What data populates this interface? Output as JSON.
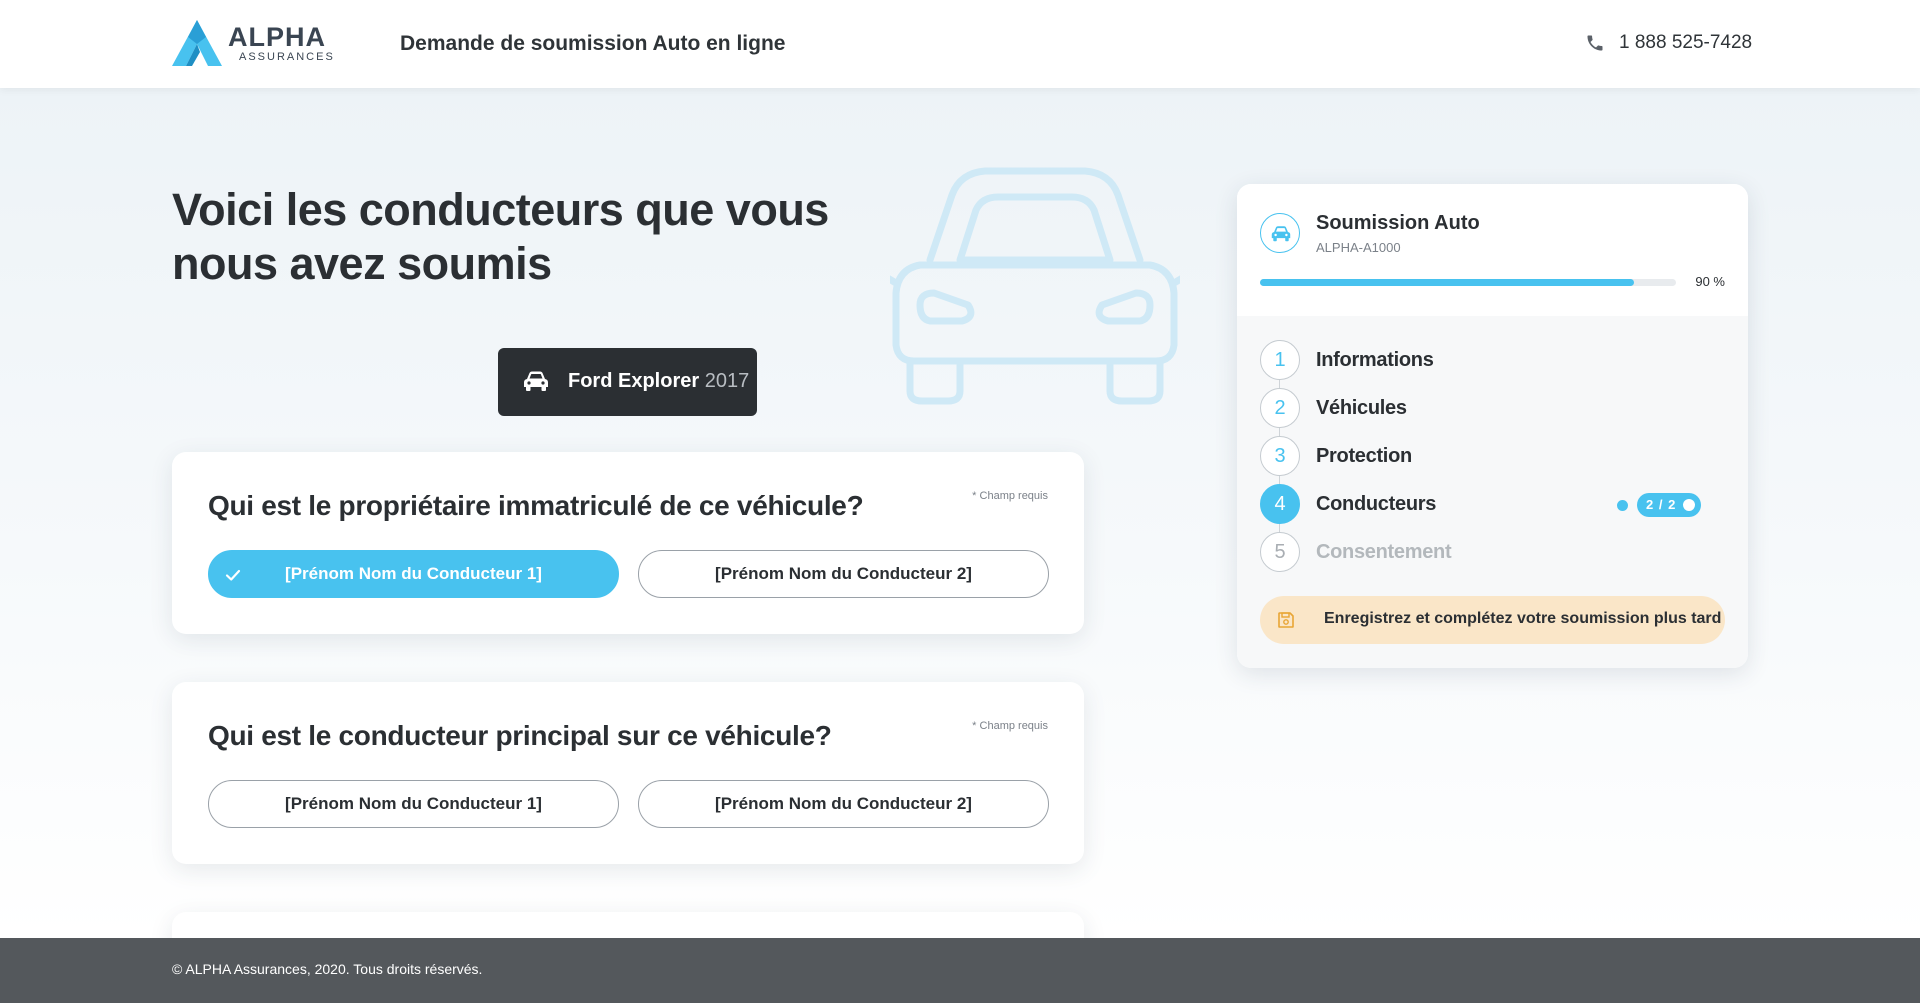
{
  "header": {
    "logo_name": "ALPHA",
    "logo_sub": "ASSURANCES",
    "title": "Demande de soumission Auto en ligne",
    "phone": "1 888 525-7428"
  },
  "main": {
    "heading": "Voici les conducteurs que vous nous avez soumis",
    "vehicle": {
      "make_model": "Ford Explorer",
      "year": "2017"
    },
    "questions": [
      {
        "title": "Qui est le propriétaire immatriculé de ce véhicule?",
        "required": "* Champ requis",
        "options": [
          "[Prénom Nom du Conducteur 1]",
          "[Prénom Nom du Conducteur 2]"
        ],
        "selected": 0
      },
      {
        "title": "Qui est le conducteur principal sur ce véhicule?",
        "required": "* Champ requis",
        "options": [
          "[Prénom Nom du Conducteur 1]",
          "[Prénom Nom du Conducteur 2]"
        ],
        "selected": null
      }
    ]
  },
  "sidebar": {
    "title": "Soumission Auto",
    "ref": "ALPHA-A1000",
    "progress_percent": 90,
    "progress_label": "90 %",
    "steps": [
      {
        "num": "1",
        "label": "Informations",
        "state": "done"
      },
      {
        "num": "2",
        "label": "Véhicules",
        "state": "done"
      },
      {
        "num": "3",
        "label": "Protection",
        "state": "done"
      },
      {
        "num": "4",
        "label": "Conducteurs",
        "state": "active",
        "badge": "2 / 2"
      },
      {
        "num": "5",
        "label": "Consentement",
        "state": "pending"
      }
    ],
    "save_label": "Enregistrez et complétez votre soumission plus tard"
  },
  "footer": {
    "text": "© ALPHA Assurances, 2020. Tous droits réservés."
  },
  "icons": {
    "phone": "phone-icon",
    "car": "car-icon",
    "check": "check-icon",
    "save": "floppy-disk-icon"
  },
  "colors": {
    "accent": "#48c2ef",
    "dark": "#2b2f33",
    "save_bg": "#fae6c8",
    "footer": "#54585c"
  }
}
